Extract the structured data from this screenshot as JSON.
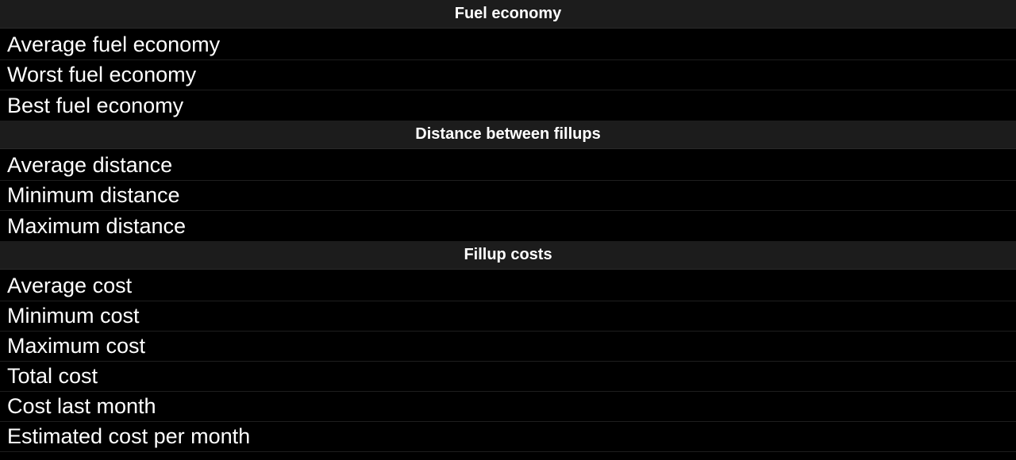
{
  "sections": [
    {
      "header": "Fuel economy",
      "rows": [
        "Average fuel economy",
        "Worst fuel economy",
        "Best fuel economy"
      ]
    },
    {
      "header": "Distance between fillups",
      "rows": [
        "Average distance",
        "Minimum distance",
        "Maximum distance"
      ]
    },
    {
      "header": "Fillup costs",
      "rows": [
        "Average cost",
        "Minimum cost",
        "Maximum cost",
        "Total cost",
        "Cost last month",
        "Estimated cost per month"
      ]
    }
  ]
}
